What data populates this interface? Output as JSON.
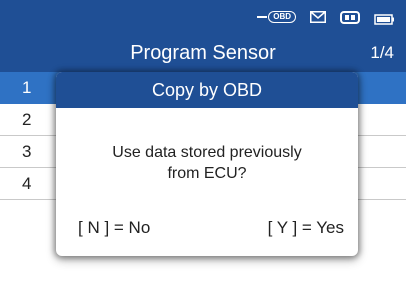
{
  "status_bar": {
    "obd_label": "OBD",
    "icons": [
      "obd-connector-icon",
      "mail-icon",
      "vci-icon",
      "battery-icon"
    ]
  },
  "header": {
    "title": "Program Sensor",
    "page": "1/4"
  },
  "list": {
    "items": [
      {
        "number": "1",
        "label": ""
      },
      {
        "number": "2",
        "label": ""
      },
      {
        "number": "3",
        "label": ""
      },
      {
        "number": "4",
        "label": ""
      }
    ]
  },
  "dialog": {
    "title": "Copy by OBD",
    "message_line1": "Use data stored previously",
    "message_line2": "from ECU?",
    "no_label": "[ N ] = No",
    "yes_label": "[ Y ] = Yes"
  },
  "colors": {
    "header_bg": "#1f4f95",
    "selection": "#2f72c4",
    "background": "#ffffff"
  }
}
